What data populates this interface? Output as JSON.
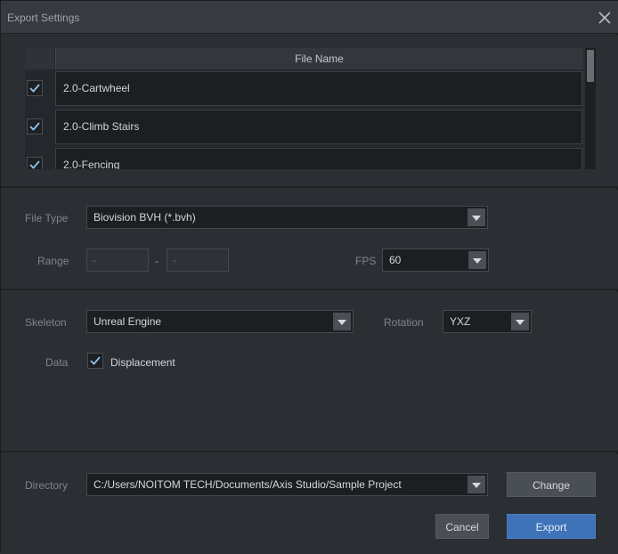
{
  "window": {
    "title": "Export Settings"
  },
  "icons": {
    "close": "close-icon",
    "check": "checkmark-icon",
    "dropdown": "chevron-down-icon"
  },
  "files": {
    "column_header": "File Name",
    "rows": [
      {
        "name": "2.0-Cartwheel",
        "checked": true
      },
      {
        "name": "2.0-Climb Stairs",
        "checked": true
      },
      {
        "name": "2.0-Fencing",
        "checked": true
      }
    ]
  },
  "format": {
    "file_type_label": "File Type",
    "file_type_value": "Biovision BVH (*.bvh)",
    "range_label": "Range",
    "range_start_placeholder": "-",
    "range_separator": "-",
    "range_end_placeholder": "-",
    "fps_label": "FPS",
    "fps_value": "60"
  },
  "skeleton": {
    "skeleton_label": "Skeleton",
    "skeleton_value": "Unreal Engine",
    "rotation_label": "Rotation",
    "rotation_value": "YXZ",
    "data_label": "Data",
    "displacement_label": "Displacement",
    "displacement_checked": true
  },
  "directory": {
    "label": "Directory",
    "value": "C:/Users/NOITOM TECH/Documents/Axis Studio/Sample Project",
    "change_label": "Change"
  },
  "actions": {
    "cancel_label": "Cancel",
    "export_label": "Export"
  },
  "colors": {
    "accent": "#3f73b8",
    "check": "#8ec3f0",
    "background": "#2b2e33"
  }
}
